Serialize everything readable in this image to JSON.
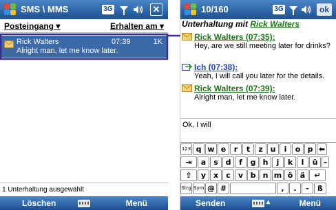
{
  "left_screen": {
    "title": "SMS \\ MMS",
    "badge_3g": "3G",
    "signal_icon": "signal-icon",
    "volume_icon": "speaker-icon",
    "close_label": "✕",
    "header": {
      "folder": "Posteingang ▾",
      "sort": "Erhalten am ▾"
    },
    "messages": [
      {
        "sender": "Rick Walters",
        "time": "07:39",
        "size": "1K",
        "preview": "Alright man, let me know later."
      }
    ],
    "status": "1 Unterhaltung ausgewählt",
    "soft_left": "Löschen",
    "soft_right": "Menü"
  },
  "right_screen": {
    "title": "10/160",
    "badge_3g": "3G",
    "ok_label": "ok",
    "conversation_prefix": "Unterhaltung mit ",
    "conversation_name": "Rick Walters",
    "messages": [
      {
        "sender": "Rick Walters (07:35):",
        "body": "Hey, are we still meeting later for drinks?",
        "from_me": false
      },
      {
        "sender": "Ich (07:38):",
        "body": "Yeah, I will call you later for the details.",
        "from_me": true
      },
      {
        "sender": "Rick Walters (07:39):",
        "body": "Alright man, let me know later.",
        "from_me": false
      }
    ],
    "compose_text": "Ok, I will",
    "keyboard": {
      "row1": [
        "123",
        "q",
        "w",
        "e",
        "r",
        "t",
        "z",
        "u",
        "i",
        "o",
        "p",
        "⬅"
      ],
      "row2": [
        "⇥",
        "a",
        "s",
        "d",
        "f",
        "g",
        "h",
        "j",
        "k",
        "l",
        "ü",
        "–"
      ],
      "row3": [
        "⇧",
        "y",
        "x",
        "c",
        "v",
        "b",
        "n",
        "m",
        "ö",
        "ä",
        "↵"
      ],
      "row4": [
        "Strg",
        "Sym",
        "@",
        "#",
        " ",
        ",",
        ".",
        "-",
        "ß"
      ]
    },
    "soft_left": "Senden",
    "soft_right": "Menü"
  },
  "colors": {
    "title_bar": "#1d4f8f",
    "selection": "#3c69a8",
    "sender_green": "#1a7a1a",
    "me_blue": "#1c3fbf",
    "highlight_frame": "#3a2f8f"
  }
}
